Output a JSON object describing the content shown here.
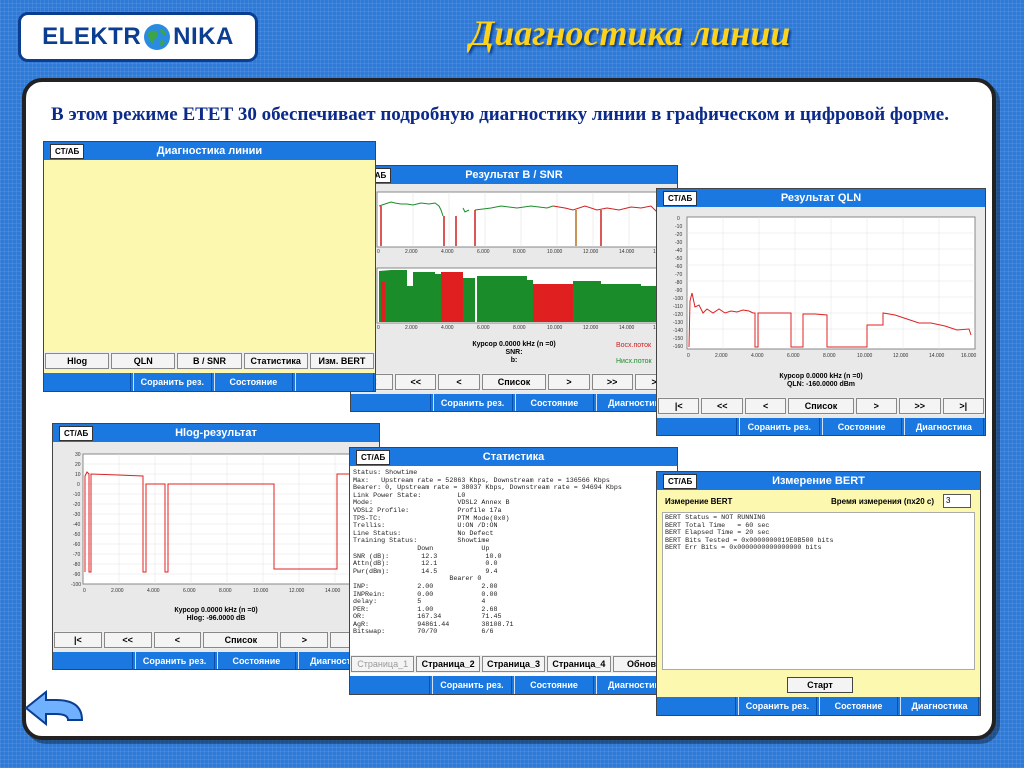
{
  "header": {
    "logo_left": "ELEKTR",
    "logo_right": "NIKA",
    "title": "Диагностика линии"
  },
  "subtitle": "В этом режиме ЕТЕТ 30 обеспечивает подробную диагностику линии в графическом и цифровой форме.",
  "icons": {
    "globe": "globe-icon",
    "back": "back-arrow-icon"
  },
  "colors": {
    "accent": "#1a78e0",
    "title": "#ffd21a",
    "panel_yellow": "#fdf8b0"
  },
  "common": {
    "stab": "СТ/АБ",
    "save": "Соранить рез.",
    "state": "Состояние",
    "diag": "Диагностика"
  },
  "win_diag": {
    "title": "Диагностика линии",
    "tabs": [
      "Hlog",
      "QLN",
      "B / SNR",
      "Статистика",
      "Изм. BERT"
    ]
  },
  "win_bsnr": {
    "title": "Результат B / SNR",
    "xticks": [
      "0",
      "2.000",
      "4.000",
      "6.000",
      "8.000",
      "10.000",
      "12.000",
      "14.000",
      "16.000"
    ],
    "cursor": "Курсор 0.0000 kHz (n =0)",
    "snr": "SNR:",
    "b": "b:",
    "upstream": "Восх.поток",
    "downstream": "Нисх.поток",
    "nav": [
      "|<",
      "<<",
      "<",
      "Список",
      ">",
      ">>",
      ">|"
    ]
  },
  "win_qln": {
    "title": "Результат QLN",
    "yticks": [
      "0",
      "-10",
      "-20",
      "-30",
      "-40",
      "-50",
      "-60",
      "-70",
      "-80",
      "-90",
      "-100",
      "-110",
      "-120",
      "-130",
      "-140",
      "-150",
      "-160"
    ],
    "xticks": [
      "0",
      "2.000",
      "4.000",
      "6.000",
      "8.000",
      "10.000",
      "12.000",
      "14.000",
      "16.000"
    ],
    "cursor": "Курсор 0.0000 kHz (n =0)",
    "value": "QLN: -160.0000 dBm",
    "nav": [
      "|<",
      "<<",
      "<",
      "Список",
      ">",
      ">>",
      ">|"
    ]
  },
  "win_hlog": {
    "title": "Hlog-результат",
    "yticks": [
      "30",
      "20",
      "10",
      "0",
      "-10",
      "-20",
      "-30",
      "-40",
      "-50",
      "-60",
      "-70",
      "-80",
      "-90",
      "-100"
    ],
    "xticks": [
      "0",
      "2.000",
      "4.000",
      "6.000",
      "8.000",
      "10.000",
      "12.000",
      "14.000",
      "16.000"
    ],
    "cursor": "Курсор 0.0000 kHz (n =0)",
    "value": "Hlog: -96.0000 dB",
    "nav": [
      "|<",
      "<<",
      "<",
      "Список",
      ">",
      ">>"
    ]
  },
  "win_stat": {
    "title": "Статистика",
    "text": "Status: Showtime\nMax:   Upstream rate = 52863 Kbps, Downstream rate = 136566 Kbps\nBearer: 0, Upstream rate = 38037 Kbps, Downstream rate = 94694 Kbps\nLink Power State:         L0\nMode:                     VDSL2 Annex B\nVDSL2 Profile:            Profile 17a\nTPS-TC:                   PTM Mode(0x0)\nTrellis:                  U:ON /D:ON\nLine Status:              No Defect\nTraining Status:          Showtime\n                Down            Up\nSNR (dB):        12.3            10.0\nAttn(dB):        12.1            0.0\nPwr(dBm):        14.5            9.4\n                        Bearer 0\nINP:            2.00            2.00\nINPRein:        0.00            0.00\ndelay:          5               4\nPER:            1.00            2.68\nOR:             167.34          71.45\nAgR:            94861.44        38108.71\nBitswap:        70/70           6/6",
    "pages": [
      "Страница_1",
      "Страница_2",
      "Страница_3",
      "Страница_4",
      "Обнови"
    ]
  },
  "win_bert": {
    "title": "Измерение BERT",
    "label": "Измерение BERT",
    "time_label": "Время измерения (пх20 с)",
    "time_value": "3",
    "text": "BERT Status = NOT RUNNING\nBERT Total Time   = 60 sec\nBERT Elapsed Time = 20 sec\nBERT Bits Tested = 0x0000000019E0B500 bits\nBERT Err Bits = 0x0000000000000000 bits",
    "start": "Старт"
  }
}
